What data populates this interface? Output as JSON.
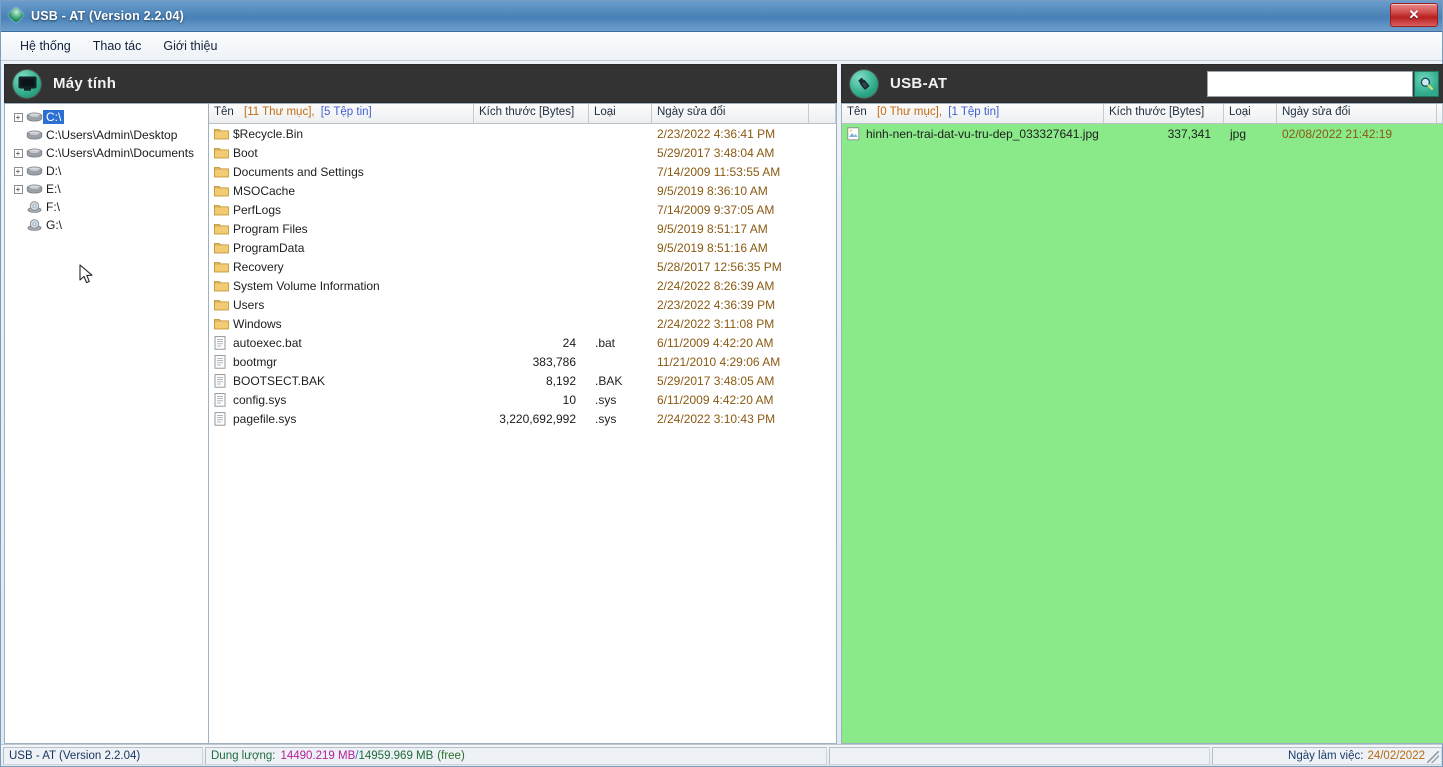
{
  "window": {
    "title": "USB - AT (Version 2.2.04)",
    "icon": "diamond-icon",
    "close_label": "✕",
    "accent": "#4e86ba"
  },
  "menu": {
    "items": [
      {
        "label": "Hệ thống"
      },
      {
        "label": "Thao tác"
      },
      {
        "label": "Giới thiệu"
      }
    ]
  },
  "left_pane": {
    "header": {
      "title": "Máy tính",
      "icon": "monitor-icon"
    },
    "tree": {
      "items": [
        {
          "label": "C:\\",
          "icon": "drive-icon",
          "expander": "+",
          "selected": true
        },
        {
          "label": "C:\\Users\\Admin\\Desktop",
          "icon": "drive-icon",
          "expander": "",
          "selected": false
        },
        {
          "label": "C:\\Users\\Admin\\Documents",
          "icon": "drive-icon",
          "expander": "+",
          "selected": false
        },
        {
          "label": "D:\\",
          "icon": "drive-icon",
          "expander": "+",
          "selected": false
        },
        {
          "label": "E:\\",
          "icon": "drive-icon",
          "expander": "+",
          "selected": false
        },
        {
          "label": "F:\\",
          "icon": "cd-drive-icon",
          "expander": "",
          "selected": false
        },
        {
          "label": "G:\\",
          "icon": "cd-drive-icon",
          "expander": "",
          "selected": false
        }
      ]
    },
    "columns": {
      "name": "Tên",
      "dir_count": "[11 Thư mục],",
      "file_count": "[5 Tệp tin]",
      "size": "Kích thước [Bytes]",
      "type": "Loại",
      "date": "Ngày sửa đổi"
    },
    "rows": [
      {
        "name": "$Recycle.Bin",
        "icon": "folder-icon",
        "size": "",
        "type": "",
        "date": "2/23/2022 4:36:41 PM"
      },
      {
        "name": "Boot",
        "icon": "folder-icon",
        "size": "",
        "type": "",
        "date": "5/29/2017 3:48:04 AM"
      },
      {
        "name": "Documents and Settings",
        "icon": "folder-icon",
        "size": "",
        "type": "",
        "date": "7/14/2009 11:53:55 AM"
      },
      {
        "name": "MSOCache",
        "icon": "folder-icon",
        "size": "",
        "type": "",
        "date": "9/5/2019 8:36:10 AM"
      },
      {
        "name": "PerfLogs",
        "icon": "folder-icon",
        "size": "",
        "type": "",
        "date": "7/14/2009 9:37:05 AM"
      },
      {
        "name": "Program Files",
        "icon": "folder-icon",
        "size": "",
        "type": "",
        "date": "9/5/2019 8:51:17 AM"
      },
      {
        "name": "ProgramData",
        "icon": "folder-icon",
        "size": "",
        "type": "",
        "date": "9/5/2019 8:51:16 AM"
      },
      {
        "name": "Recovery",
        "icon": "folder-icon",
        "size": "",
        "type": "",
        "date": "5/28/2017 12:56:35 PM"
      },
      {
        "name": "System Volume Information",
        "icon": "folder-icon",
        "size": "",
        "type": "",
        "date": "2/24/2022 8:26:39 AM"
      },
      {
        "name": "Users",
        "icon": "folder-icon",
        "size": "",
        "type": "",
        "date": "2/23/2022 4:36:39 PM"
      },
      {
        "name": "Windows",
        "icon": "folder-icon",
        "size": "",
        "type": "",
        "date": "2/24/2022 3:11:08 PM"
      },
      {
        "name": "autoexec.bat",
        "icon": "file-icon",
        "size": "24",
        "type": ".bat",
        "date": "6/11/2009 4:42:20 AM"
      },
      {
        "name": "bootmgr",
        "icon": "file-icon",
        "size": "383,786",
        "type": "",
        "date": "11/21/2010 4:29:06 AM"
      },
      {
        "name": "BOOTSECT.BAK",
        "icon": "file-icon",
        "size": "8,192",
        "type": ".BAK",
        "date": "5/29/2017 3:48:05 AM"
      },
      {
        "name": "config.sys",
        "icon": "file-icon",
        "size": "10",
        "type": ".sys",
        "date": "6/11/2009 4:42:20 AM"
      },
      {
        "name": "pagefile.sys",
        "icon": "file-icon",
        "size": "3,220,692,992",
        "type": ".sys",
        "date": "2/24/2022 3:10:43 PM"
      }
    ]
  },
  "right_pane": {
    "header": {
      "title": "USB-AT",
      "icon": "usb-icon"
    },
    "search": {
      "value": "",
      "placeholder": "",
      "button_icon": "search-icon"
    },
    "columns": {
      "name": "Tên",
      "dir_count": "[0 Thư mục],",
      "file_count": "[1 Tệp tin]",
      "size": "Kích thước [Bytes]",
      "type": "Loại",
      "date": "Ngày sửa đổi"
    },
    "rows": [
      {
        "name": "hinh-nen-trai-dat-vu-tru-dep_033327641.jpg",
        "icon": "image-file-icon",
        "size": "337,341",
        "type": "jpg",
        "date": "02/08/2022 21:42:19"
      }
    ],
    "background_color": "#8ae989"
  },
  "statusbar": {
    "app": "USB - AT (Version 2.2.04)",
    "capacity_label": "Dung lượng:",
    "capacity_used": "14490.219 MB",
    "capacity_sep": "/",
    "capacity_total": "14959.969 MB",
    "capacity_free": "(free)",
    "date_label": "Ngày làm việc:",
    "date_value": "24/02/2022"
  }
}
